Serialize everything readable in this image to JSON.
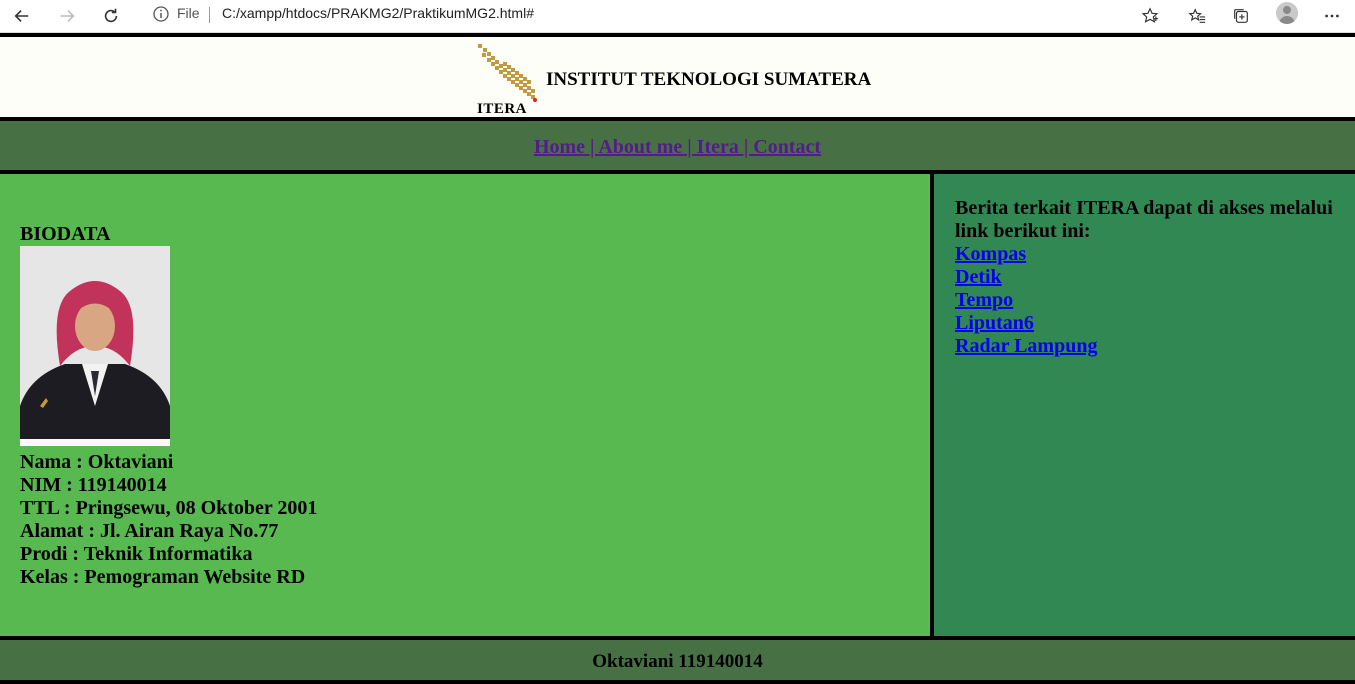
{
  "browser": {
    "file_label": "File",
    "url": "C:/xampp/htdocs/PRAKMG2/PraktikumMG2.html#"
  },
  "header": {
    "logo_text": "ITERA",
    "title": "INSTITUT TEKNOLOGI SUMATERA"
  },
  "nav": {
    "home": "Home",
    "about": "About me",
    "itera": "Itera",
    "contact": "Contact",
    "separator": " | "
  },
  "main": {
    "title": "BIODATA",
    "lines": [
      "Nama : Oktaviani",
      "NIM : 119140014",
      "TTL : Pringsewu, 08 Oktober 2001",
      "Alamat : Jl. Airan Raya No.77",
      "Prodi : Teknik Informatika",
      "Kelas : Pemograman Website RD"
    ]
  },
  "sidebar": {
    "intro": "Berita terkait ITERA dapat di akses melalui link berikut ini:",
    "links": [
      "Kompas",
      "Detik",
      "Tempo",
      "Liputan6",
      "Radar Lampung"
    ]
  },
  "footer": {
    "text": "Oktaviani 119140014"
  }
}
